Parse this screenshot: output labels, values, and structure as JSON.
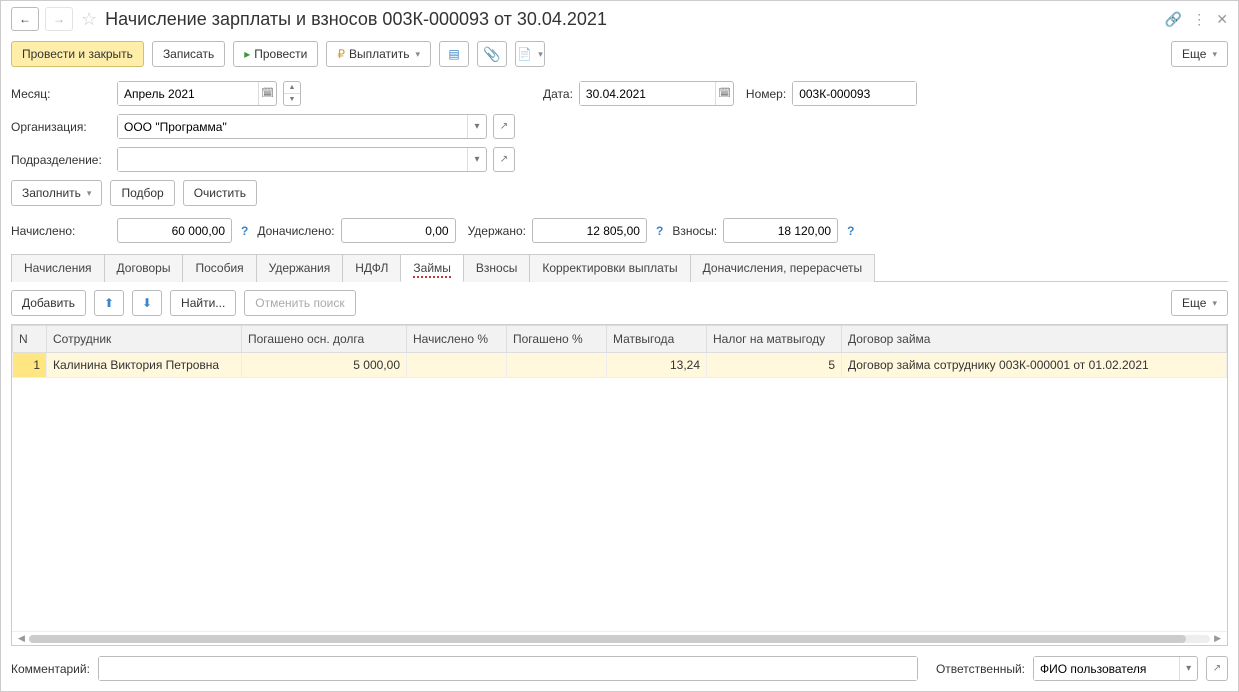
{
  "title": "Начисление зарплаты и взносов 003К-000093 от 30.04.2021",
  "toolbar": {
    "post_close": "Провести и закрыть",
    "save": "Записать",
    "post": "Провести",
    "pay": "Выплатить",
    "more": "Еще"
  },
  "fields": {
    "month_label": "Месяц:",
    "month_value": "Апрель 2021",
    "date_label": "Дата:",
    "date_value": "30.04.2021",
    "number_label": "Номер:",
    "number_value": "003К-000093",
    "org_label": "Организация:",
    "org_value": "ООО \"Программа\"",
    "dept_label": "Подразделение:",
    "dept_value": ""
  },
  "fill_row": {
    "fill": "Заполнить",
    "pick": "Подбор",
    "clear": "Очистить"
  },
  "sums": {
    "accrued_label": "Начислено:",
    "accrued": "60 000,00",
    "extra_label": "Доначислено:",
    "extra": "0,00",
    "withheld_label": "Удержано:",
    "withheld": "12 805,00",
    "contrib_label": "Взносы:",
    "contrib": "18 120,00"
  },
  "tabs": [
    "Начисления",
    "Договоры",
    "Пособия",
    "Удержания",
    "НДФЛ",
    "Займы",
    "Взносы",
    "Корректировки выплаты",
    "Доначисления, перерасчеты"
  ],
  "active_tab": 5,
  "tab_toolbar": {
    "add": "Добавить",
    "find": "Найти...",
    "cancel_search": "Отменить поиск",
    "more": "Еще"
  },
  "table": {
    "columns": [
      "N",
      "Сотрудник",
      "Погашено осн. долга",
      "Начислено %",
      "Погашено %",
      "Матвыгода",
      "Налог на матвыгоду",
      "Договор займа"
    ],
    "rows": [
      {
        "n": "1",
        "employee": "Калинина Виктория Петровна",
        "principal": "5 000,00",
        "accr_pct": "",
        "paid_pct": "",
        "benefit": "13,24",
        "tax": "5",
        "contract": "Договор займа сотруднику 003К-000001 от 01.02.2021"
      }
    ]
  },
  "bottom": {
    "comment_label": "Комментарий:",
    "comment_value": "",
    "resp_label": "Ответственный:",
    "resp_value": "ФИО пользователя"
  }
}
